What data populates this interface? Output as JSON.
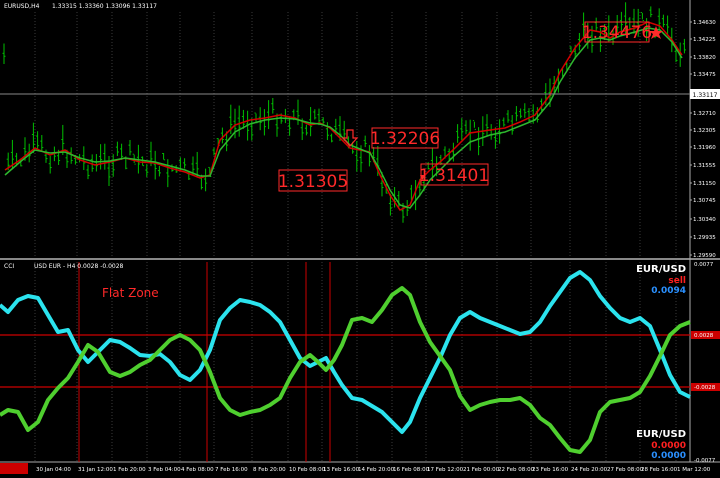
{
  "window": {
    "symbol_info": "EURUSD,H4",
    "ohlc": "1.33315 1.33360 1.33096 1.33117",
    "subwindow_title": "CCI",
    "subwindow_params": "USD EUR - H4 0.0028 -0.0028"
  },
  "price_axis": {
    "labels": [
      "1.34630",
      "1.34225",
      "1.33820",
      "1.33475",
      "1.33117",
      "1.32710",
      "1.32305",
      "1.31960",
      "1.31555",
      "1.31150",
      "1.30745",
      "1.30340",
      "1.29935",
      "1.29590"
    ],
    "current_price": "1.33117"
  },
  "indicator_axis": {
    "labels": [
      "0.0077",
      "0.0028",
      "-0.0028",
      "-0.0077"
    ]
  },
  "time_axis": {
    "labels": [
      "30 Jan 04:00",
      "31 Jan 12:00",
      "1 Feb 20:00",
      "3 Feb 04:00",
      "4 Feb 08:00",
      "7 Feb 16:00",
      "8 Feb 20:00",
      "10 Feb 08:00",
      "13 Feb 16:00",
      "14 Feb 20:00",
      "16 Feb 08:00",
      "17 Feb 12:00",
      "21 Feb 00:00",
      "22 Feb 08:00",
      "23 Feb 16:00",
      "24 Feb 20:00",
      "27 Feb 08:00",
      "28 Feb 16:00",
      "1 Mar 12:00"
    ]
  },
  "annotations": {
    "flat_zone": "Flat Zone",
    "price_labels": [
      "1.31305",
      "1.32206",
      "1.31401",
      "1.34476"
    ]
  },
  "panel_top_right": {
    "pair": "EUR/USD",
    "signal": "sell",
    "value": "0.0094"
  },
  "panel_bottom_right": {
    "pair": "EUR/USD",
    "value_red": "0.0000",
    "value_blue": "0.0000"
  },
  "colors": {
    "background": "#000000",
    "candles": "#00cc00",
    "ma_fast": "#d40000",
    "ma_slow": "#2eb82e",
    "cyan_line": "#2be3ee",
    "green_line": "#4fcf2f",
    "red_levels": "#cc0000",
    "label_red": "#ff2a2a"
  },
  "chart_data": {
    "type": "line",
    "price": {
      "x": [
        "30 Jan 04:00",
        "31 Jan 12:00",
        "1 Feb 20:00",
        "3 Feb 04:00",
        "4 Feb 08:00",
        "7 Feb 16:00",
        "8 Feb 20:00",
        "10 Feb 08:00",
        "13 Feb 16:00",
        "14 Feb 20:00",
        "16 Feb 08:00",
        "17 Feb 12:00",
        "21 Feb 00:00",
        "22 Feb 08:00",
        "23 Feb 16:00",
        "24 Feb 20:00",
        "27 Feb 08:00",
        "28 Feb 16:00",
        "1 Mar 12:00"
      ],
      "close": [
        1.3155,
        1.318,
        1.317,
        1.315,
        1.3215,
        1.3255,
        1.326,
        1.321,
        1.3175,
        1.306,
        1.311,
        1.3195,
        1.3225,
        1.3255,
        1.3385,
        1.3445,
        1.343,
        1.342,
        1.331
      ],
      "ylim": [
        1.2959,
        1.348
      ]
    },
    "indicator": {
      "series": [
        {
          "name": "USD",
          "values": [
            0.006,
            0.0005,
            0.002,
            0.0,
            -0.006,
            0.005,
            0.0,
            -0.002,
            -0.006,
            0.006,
            -0.0065,
            0.005,
            0.002,
            0.0075,
            -0.0015,
            -0.004
          ]
        },
        {
          "name": "EUR",
          "values": [
            -0.006,
            0.0015,
            -0.002,
            0.001,
            0.005,
            -0.003,
            0.001,
            0.005,
            0.004,
            -0.0055,
            0.006,
            -0.004,
            -0.0025,
            -0.007,
            0.001,
            0.004
          ]
        }
      ],
      "levels": [
        0.0028,
        -0.0028
      ],
      "ylim": [
        -0.0077,
        0.0077
      ]
    }
  }
}
